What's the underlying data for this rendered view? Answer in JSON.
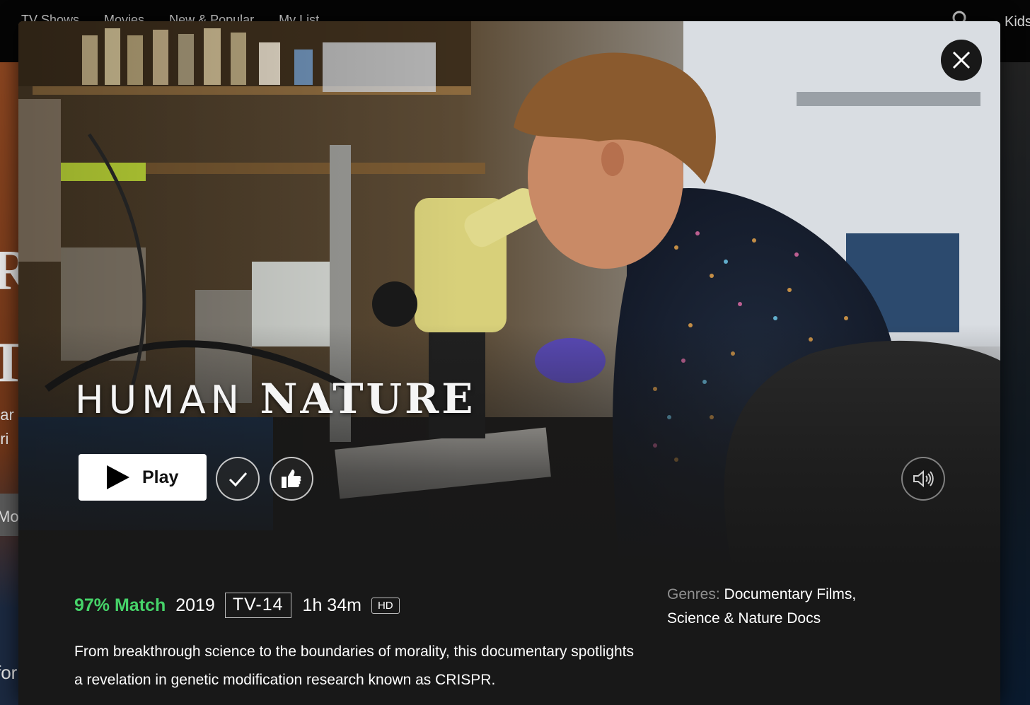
{
  "background": {
    "nav_items": [
      "TV Shows",
      "Movies",
      "New & Popular",
      "My List"
    ],
    "kids_label": "Kids",
    "fragments": [
      "R",
      "T",
      "ear",
      "uri",
      "Mo",
      "for"
    ]
  },
  "modal": {
    "title_part1": "HUMAN",
    "title_part2": "NATURE",
    "play_label": "Play",
    "icons": {
      "close": "close-icon",
      "play": "play-icon",
      "my_list": "check-icon",
      "rate": "thumbs-up-icon",
      "mute": "speaker-icon"
    },
    "match": "97% Match",
    "year": "2019",
    "maturity_rating": "TV-14",
    "runtime": "1h 34m",
    "quality": "HD",
    "synopsis": "From breakthrough science to the boundaries of morality, this documentary spotlights a revelation in genetic modification research known as CRISPR.",
    "genres_label": "Genres:",
    "genres_line1": "Documentary Films,",
    "genres_line2": "Science & Nature Docs"
  },
  "colors": {
    "match_green": "#46d369",
    "modal_bg": "#181818",
    "play_button_bg": "#ffffff"
  }
}
